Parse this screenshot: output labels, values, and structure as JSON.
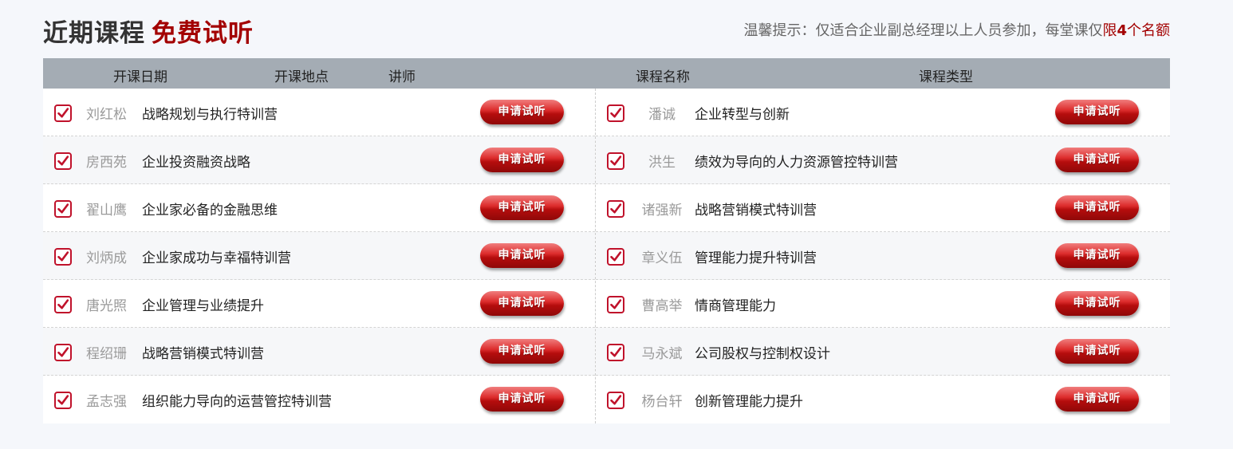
{
  "header": {
    "title_part1": "近期课程",
    "title_part2": "免费试听",
    "notice_prefix": "温馨提示：仅适合企业副总经理以上人员参加，每堂课仅",
    "notice_limit_char": "限",
    "notice_number": "4",
    "notice_suffix": "个名额"
  },
  "columns": [
    "开课日期",
    "开课地点",
    "讲师",
    "课程名称",
    "课程类型"
  ],
  "apply_label": "申请试听",
  "left_rows": [
    {
      "teacher": "刘红松",
      "course": "战略规划与执行特训营"
    },
    {
      "teacher": "房西苑",
      "course": "企业投资融资战略"
    },
    {
      "teacher": "翟山鹰",
      "course": "企业家必备的金融思维"
    },
    {
      "teacher": "刘炳成",
      "course": "企业家成功与幸福特训营"
    },
    {
      "teacher": "唐光照",
      "course": "企业管理与业绩提升"
    },
    {
      "teacher": "程绍珊",
      "course": "战略营销模式特训营"
    },
    {
      "teacher": "孟志强",
      "course": "组织能力导向的运营管控特训营"
    }
  ],
  "right_rows": [
    {
      "teacher": "潘诚",
      "course": "企业转型与创新"
    },
    {
      "teacher": "洪生",
      "course": "绩效为导向的人力资源管控特训营"
    },
    {
      "teacher": "诸强新",
      "course": "战略营销模式特训营"
    },
    {
      "teacher": "章义伍",
      "course": "管理能力提升特训营"
    },
    {
      "teacher": "曹高举",
      "course": "情商管理能力"
    },
    {
      "teacher": "马永斌",
      "course": "公司股权与控制权设计"
    },
    {
      "teacher": "杨台轩",
      "course": "创新管理能力提升"
    }
  ],
  "colors": {
    "accent": "#a30000",
    "checkbox": "#c0122b",
    "header_bg": "#a4acb4"
  },
  "icons": {
    "checkbox": "checkbox-checked-icon"
  }
}
